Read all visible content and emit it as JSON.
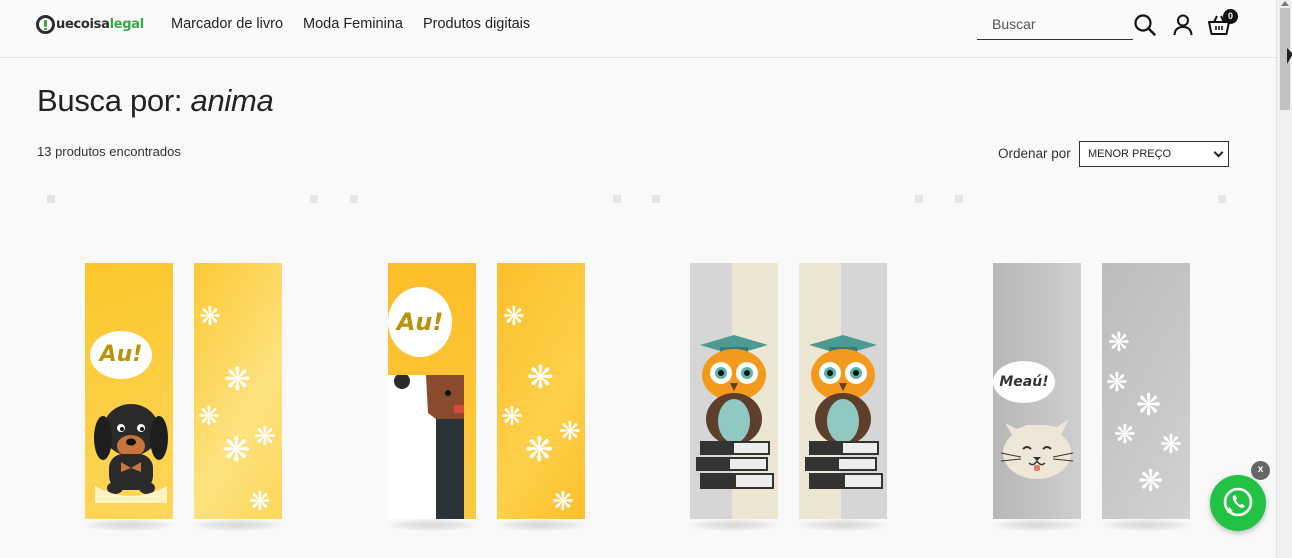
{
  "header": {
    "logo_prefix": "uecoisa",
    "logo_suffix": "legal",
    "nav": [
      "Marcador de livro",
      "Moda Feminina",
      "Produtos digitais"
    ],
    "search_placeholder": "Buscar",
    "cart_count": "0",
    "icons": [
      "search-icon",
      "user-icon",
      "cart-icon"
    ]
  },
  "main": {
    "title_prefix": "Busca por:",
    "search_term": "anima",
    "result_count": "13 produtos encontrados",
    "sort_label": "Ordenar por",
    "sort_selected": "MENOR PREÇO"
  },
  "products": [
    {
      "theme": "dachshund",
      "bubble_text": "Au!",
      "colors": [
        "#fcc62a",
        "#fde07a"
      ]
    },
    {
      "theme": "dog",
      "bubble_text": "Au!",
      "colors": [
        "#fcbd28",
        "#fdd451"
      ]
    },
    {
      "theme": "owl",
      "bubble_text": "",
      "colors": [
        "#d9d9d9",
        "#ece6d2"
      ]
    },
    {
      "theme": "cat",
      "bubble_text": "Meaú!",
      "colors": [
        "#c9c9c9",
        "#bdbdbd"
      ]
    }
  ],
  "whatsapp": {
    "close_label": "x",
    "accent": "#22c244"
  }
}
